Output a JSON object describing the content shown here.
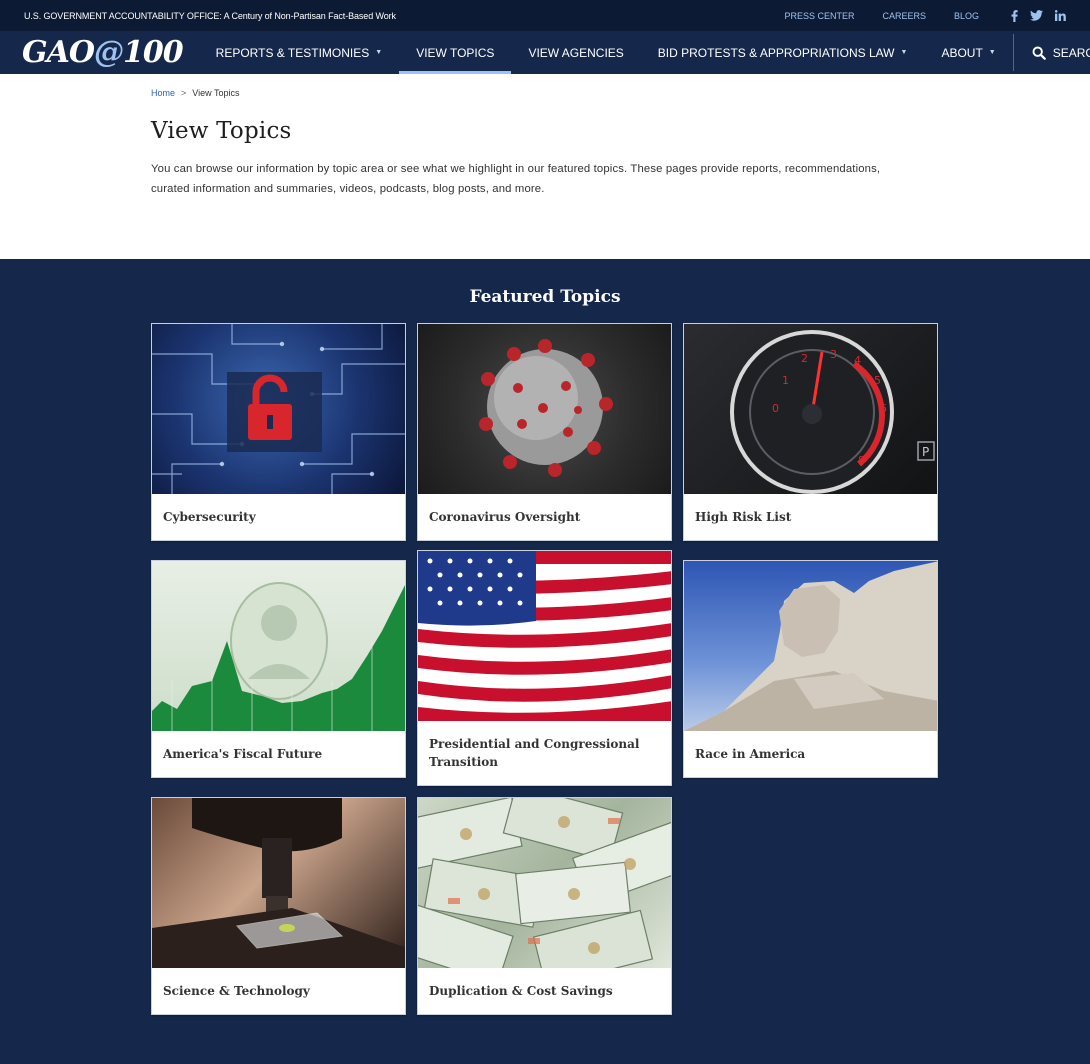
{
  "util_bar": {
    "tagline": "U.S. GOVERNMENT ACCOUNTABILITY OFFICE: A Century of Non-Partisan Fact-Based Work",
    "links": [
      "PRESS CENTER",
      "CAREERS",
      "BLOG"
    ],
    "social": [
      "facebook-icon",
      "twitter-icon",
      "linkedin-icon"
    ]
  },
  "nav": {
    "logo_main": "GAO",
    "logo_at": "@",
    "logo_num": "100",
    "items": [
      "REPORTS & TESTIMONIES",
      "VIEW TOPICS",
      "VIEW AGENCIES",
      "BID PROTESTS & APPROPRIATIONS LAW",
      "ABOUT"
    ],
    "active_index": 1,
    "search_label": "SEARCH"
  },
  "breadcrumb": {
    "home": "Home",
    "separator": ">",
    "current": "View Topics"
  },
  "page": {
    "title": "View Topics",
    "intro": "You can browse our information by topic area or see what we highlight in our featured topics. These pages provide reports, recommendations, curated information and summaries, videos, podcasts, blog posts, and more."
  },
  "featured": {
    "title": "Featured Topics",
    "cards": [
      {
        "label": "Cybersecurity"
      },
      {
        "label": "Coronavirus Oversight"
      },
      {
        "label": "High Risk List"
      },
      {
        "label": "America's Fiscal Future"
      },
      {
        "label": "Presidential and Congressional Transition"
      },
      {
        "label": "Race in America"
      },
      {
        "label": "Science & Technology"
      },
      {
        "label": "Duplication & Cost Savings"
      }
    ]
  },
  "colors": {
    "navy": "#15284b",
    "util_bar": "#0d1a33",
    "accent_link": "#9ec3f0"
  }
}
